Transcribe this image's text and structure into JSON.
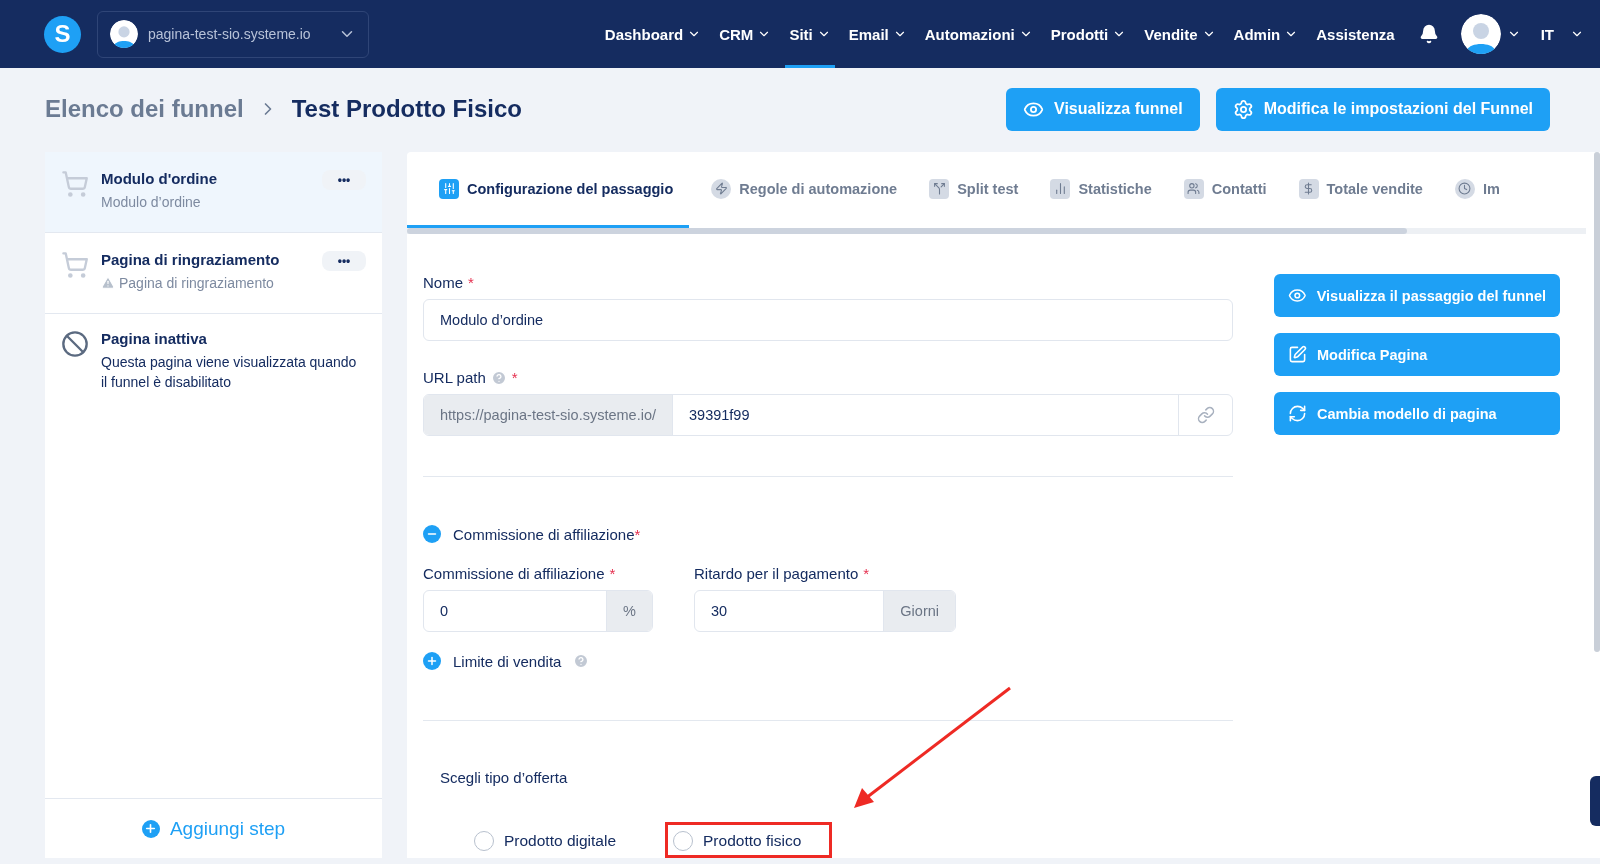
{
  "topbar": {
    "logo": "S",
    "site": "pagina-test-sio.systeme.io",
    "nav": [
      {
        "label": "Dashboard",
        "kind": "menu",
        "selected": false
      },
      {
        "label": "CRM",
        "kind": "menu",
        "selected": false
      },
      {
        "label": "Siti",
        "kind": "menu",
        "selected": true
      },
      {
        "label": "Email",
        "kind": "menu",
        "selected": false
      },
      {
        "label": "Automazioni",
        "kind": "menu",
        "selected": false
      },
      {
        "label": "Prodotti",
        "kind": "menu",
        "selected": false
      },
      {
        "label": "Vendite",
        "kind": "menu",
        "selected": false
      },
      {
        "label": "Admin",
        "kind": "menu",
        "selected": false
      },
      {
        "label": "Assistenza",
        "kind": "link",
        "selected": false
      }
    ],
    "language": "IT"
  },
  "breadcrumb": {
    "parent": "Elenco dei funnel",
    "current": "Test Prodotto Fisico"
  },
  "header_buttons": [
    {
      "label": "Visualizza funnel"
    },
    {
      "label": "Modifica le impostazioni del Funnel"
    }
  ],
  "sidebar": {
    "steps": [
      {
        "kind": "order",
        "title": "Modulo d'ordine",
        "subtitle": "Modulo d’ordine",
        "warning": false,
        "selected": true,
        "menu": "•••"
      },
      {
        "kind": "thanks",
        "title": "Pagina di ringraziamento",
        "subtitle": "Pagina di ringraziamento",
        "warning": true,
        "selected": false,
        "menu": "•••"
      },
      {
        "kind": "inactive",
        "title": "Pagina inattiva",
        "subtitle": "Questa pagina viene visualizzata quando il funnel è disabilitato",
        "warning": false,
        "selected": false
      }
    ],
    "add_button": "Aggiungi step"
  },
  "tabs": [
    {
      "label": "Configurazione del passaggio",
      "selected": true
    },
    {
      "label": "Regole di automazione",
      "selected": false
    },
    {
      "label": "Split test",
      "selected": false
    },
    {
      "label": "Statistiche",
      "selected": false
    },
    {
      "label": "Contatti",
      "selected": false
    },
    {
      "label": "Totale vendite",
      "selected": false
    },
    {
      "label": "Im",
      "selected": false
    }
  ],
  "form": {
    "name": {
      "label": "Nome",
      "required": "*",
      "value": "Modulo d’ordine"
    },
    "url": {
      "label": "URL path",
      "required": "*",
      "prefix": "https://pagina-test-sio.systeme.io/",
      "value": "39391f99"
    },
    "commission_section": {
      "label": "Commissione di affiliazione",
      "required": "*",
      "expanded": true
    },
    "commission": {
      "label": "Commissione di affiliazione",
      "required": "*",
      "value": "0",
      "suffix": "%"
    },
    "delay": {
      "label": "Ritardo per il pagamento",
      "required": "*",
      "value": "30",
      "suffix": "Giorni"
    },
    "limit_section": {
      "label": "Limite di vendita",
      "expanded": false
    },
    "offer_type": {
      "label": "Scegli tipo d’offerta",
      "options": [
        {
          "label": "Prodotto digitale",
          "selected": false,
          "highlighted": false
        },
        {
          "label": "Prodotto fisico",
          "selected": false,
          "highlighted": true
        }
      ]
    }
  },
  "side_buttons": [
    {
      "label": "Visualizza il passaggio del funnel"
    },
    {
      "label": "Modifica Pagina"
    },
    {
      "label": "Cambia modello di pagina"
    }
  ]
}
